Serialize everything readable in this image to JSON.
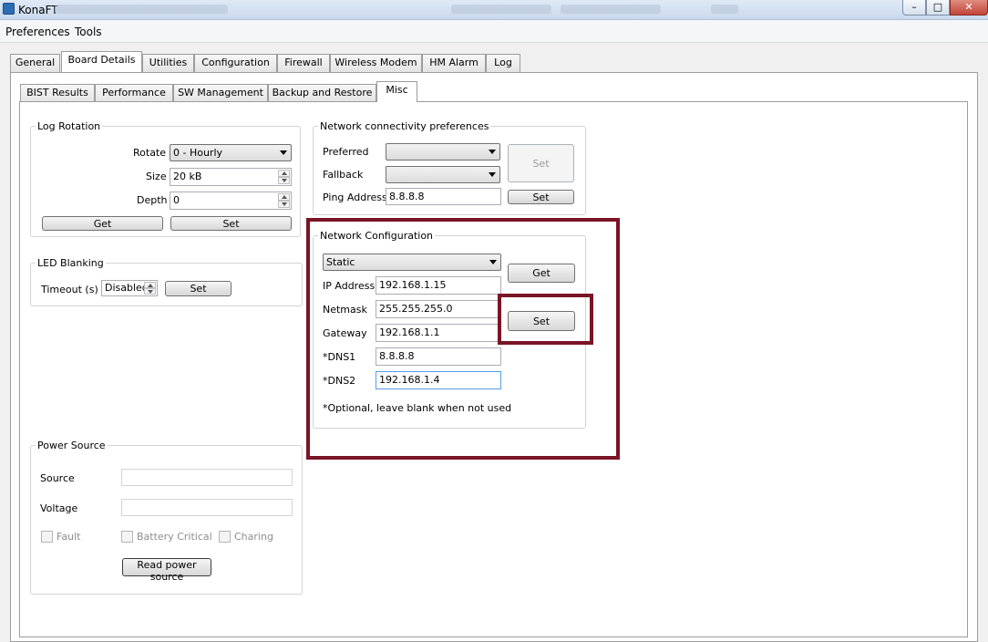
{
  "window": {
    "title": "KonaFT",
    "controls": {
      "minimize": "–",
      "maximize": "□",
      "close": "✕"
    }
  },
  "menu": [
    "Preferences",
    "Tools"
  ],
  "main_tabs": [
    "General",
    "Board Details",
    "Utilities",
    "Configuration",
    "Firewall",
    "Wireless Modem",
    "HM Alarm",
    "Log"
  ],
  "main_tab_active": "Board Details",
  "sub_tabs": [
    "BIST Results",
    "Performance",
    "SW Management",
    "Backup and Restore",
    "Misc"
  ],
  "sub_tab_active": "Misc",
  "log_rotation": {
    "title": "Log Rotation",
    "rotate_label": "Rotate",
    "rotate_value": "0 - Hourly",
    "size_label": "Size",
    "size_value": "20 kB",
    "depth_label": "Depth",
    "depth_value": "0",
    "get_label": "Get",
    "set_label": "Set"
  },
  "led_blanking": {
    "title": "LED Blanking",
    "timeout_label": "Timeout (s)",
    "timeout_value": "Disabled",
    "set_label": "Set"
  },
  "power_source": {
    "title": "Power Source",
    "source_label": "Source",
    "source_value": "",
    "voltage_label": "Voltage",
    "voltage_value": "",
    "fault_label": "Fault",
    "battery_critical_label": "Battery Critical",
    "charing_label": "Charing",
    "read_label": "Read power source"
  },
  "net_pref": {
    "title": "Network connectivity preferences",
    "preferred_label": "Preferred",
    "preferred_value": "",
    "fallback_label": "Fallback",
    "fallback_value": "",
    "ping_label": "Ping Address",
    "ping_value": "8.8.8.8",
    "set_disabled_label": "Set",
    "set_label": "Set"
  },
  "net_config": {
    "title": "Network Configuration",
    "mode_value": "Static",
    "get_label": "Get",
    "set_label": "Set",
    "ip_label": "IP Address",
    "ip_value": "192.168.1.15",
    "netmask_label": "Netmask",
    "netmask_value": "255.255.255.0",
    "gateway_label": "Gateway",
    "gateway_value": "192.168.1.1",
    "dns1_label": "*DNS1",
    "dns1_value": "8.8.8.8",
    "dns2_label": "*DNS2",
    "dns2_value": "192.168.1.4",
    "note": "*Optional, leave blank when not used"
  },
  "colors": {
    "highlight": "#7a1426"
  }
}
